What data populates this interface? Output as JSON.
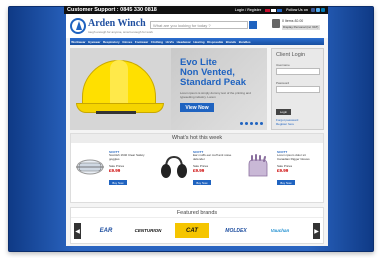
{
  "topbar": {
    "support": "Customer Support : 0845 330 0818",
    "login": "Login / Register",
    "follow": "Follow Us on"
  },
  "header": {
    "brand": "Arden Winch",
    "tagline": "tough enough for anyone, smart enough for work",
    "search_placeholder": "What are you looking for today ?",
    "cart": "0 Items   £0.00",
    "checkout": "Display Personal (inc VAT)"
  },
  "nav": [
    "Workwear",
    "Eyewear",
    "Respiratory",
    "Gloves",
    "Footwear",
    "Clothing",
    "Hi-Vis",
    "Headwear",
    "Hearing",
    "Disposable",
    "Brands",
    "Bundles"
  ],
  "hero": {
    "title": "Evo Lite\nNon Vented,\nStandard Peak",
    "description": "Lorem ipsum is simply dummy text of the printing and typesetting industry. Lorem",
    "button": "View Now"
  },
  "login": {
    "title": "Client Login",
    "username_label": "Username",
    "password_label": "Password",
    "button": "Login",
    "forgot": "Forgot password",
    "register": "Register here"
  },
  "hot": {
    "title": "What's hot this week",
    "products": [
      {
        "brand": "SCOTT",
        "name": "Scottish 1640 Clear Safety goggles",
        "sale": "Sale Prices",
        "price": "£9.99",
        "button": "Buy Now"
      },
      {
        "brand": "SCOTT",
        "name": "Ear muffs ear muff anti noise defender",
        "sale": "Sale Prices",
        "price": "£9.99",
        "button": "Buy Now"
      },
      {
        "brand": "SCOTT",
        "name": "Lorem ipsum dolor sit Canadian Rigger Gloves",
        "sale": "Sale Prices",
        "price": "£9.99",
        "button": "Buy Now"
      }
    ]
  },
  "brands": {
    "title": "Featured brands",
    "items": [
      {
        "name": "EAR",
        "color": "#1f4fa0"
      },
      {
        "name": "CENTURION",
        "color": "#111111"
      },
      {
        "name": "CAT",
        "color": "#111111"
      },
      {
        "name": "MOLDEX",
        "color": "#1f4fa0"
      },
      {
        "name": "Vauchan",
        "color": "#1f8fd0"
      }
    ]
  }
}
